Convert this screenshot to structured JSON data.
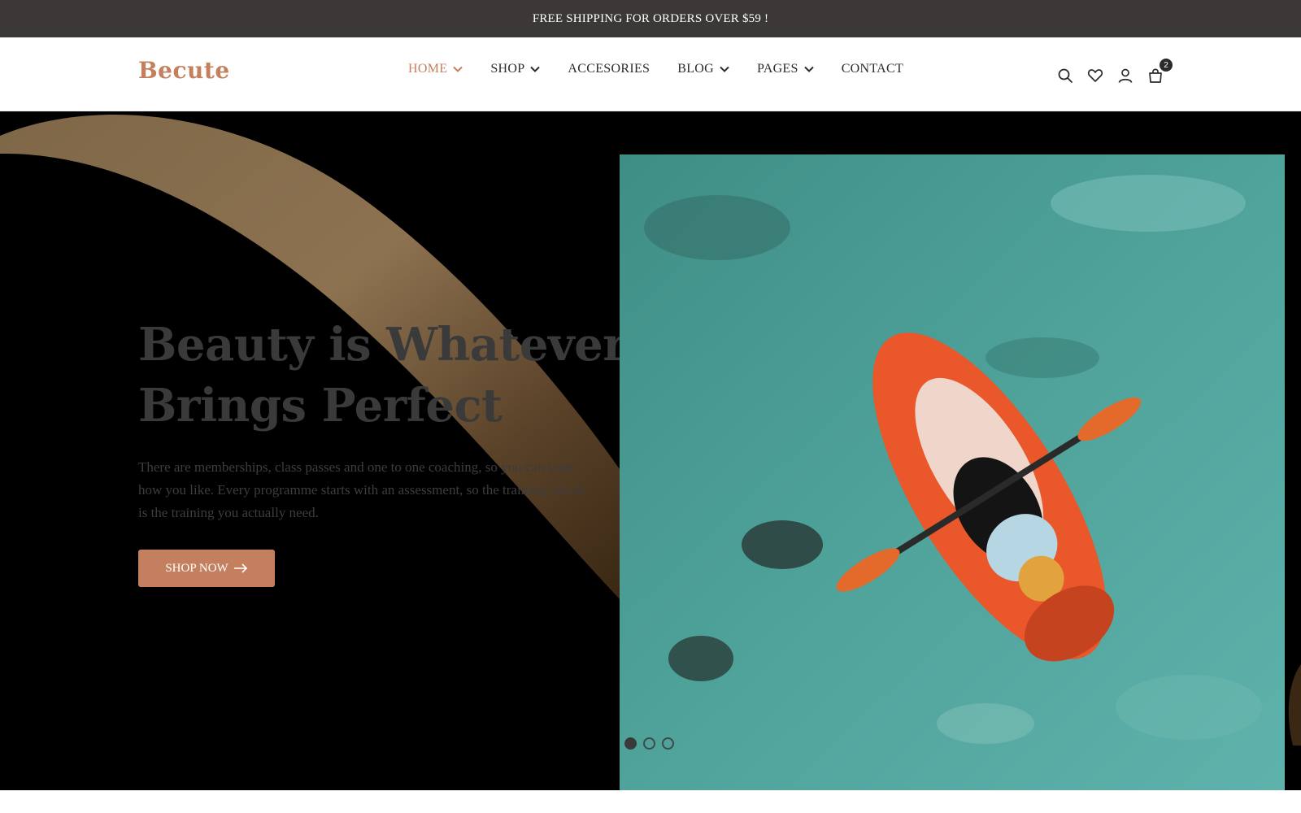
{
  "topbar": {
    "text": "FREE SHIPPING FOR ORDERS OVER $59 !"
  },
  "header": {
    "logo": "Becute",
    "nav": [
      {
        "label": "HOME",
        "has_dropdown": true,
        "active": true
      },
      {
        "label": "SHOP",
        "has_dropdown": true,
        "active": false
      },
      {
        "label": "ACCESORIES",
        "has_dropdown": false,
        "active": false
      },
      {
        "label": "BLOG",
        "has_dropdown": true,
        "active": false
      },
      {
        "label": "PAGES",
        "has_dropdown": true,
        "active": false
      },
      {
        "label": "CONTACT",
        "has_dropdown": false,
        "active": false
      }
    ],
    "icons": [
      "search-icon",
      "heart-icon",
      "user-icon",
      "cart-icon"
    ],
    "cart_count": "2"
  },
  "hero": {
    "headline_line1": "Beauty is Whatever",
    "headline_line2": "Brings Perfect",
    "description": "There are memberships, class passes and one to one coaching, so you can train\nhow you like. Every programme starts with an assessment, so the training you do\nis the training you actually need.",
    "button_label": "SHOP NOW",
    "slides": 3,
    "active_slide": 1
  },
  "colors": {
    "accent": "#c47f5e",
    "topbar_bg": "#3b3837",
    "hero_bg": "#000000",
    "swoosh": "#8a7050",
    "text_dark": "#2b2b2b"
  }
}
